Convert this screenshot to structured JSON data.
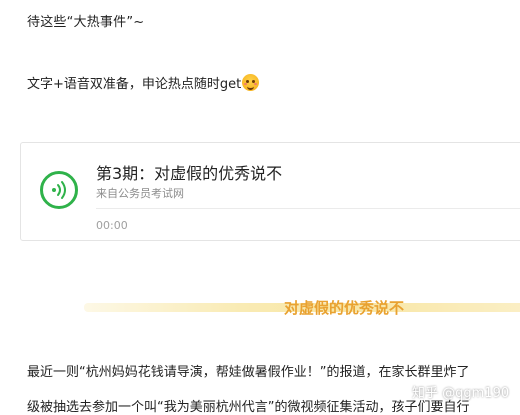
{
  "article": {
    "line1": "待这些“大热事件”~",
    "line2": "文字+语音双准备，申论热点随时get",
    "line2_emoji": "grinning-face-emoji"
  },
  "audio_card": {
    "title": "第3期：对虚假的优秀说不",
    "source": "来自公务员考试网",
    "time": "00:00",
    "progress": 0,
    "icon": "sound-wave-icon",
    "accent_color": "#2fb24a"
  },
  "section": {
    "title": "对虚假的优秀说不",
    "title_color": "#e9a231",
    "band_color": "#f8e6a4"
  },
  "body": {
    "para1": "最近一则“杭州妈妈花钱请导演，帮娃做暑假作业！”的报道，在家长群里炸了",
    "para2": "级被抽选去参加一个叫“我为美丽杭州代言”的微视频征集活动，孩子们要自行"
  },
  "watermark": {
    "text": "知乎 @qgm190"
  }
}
